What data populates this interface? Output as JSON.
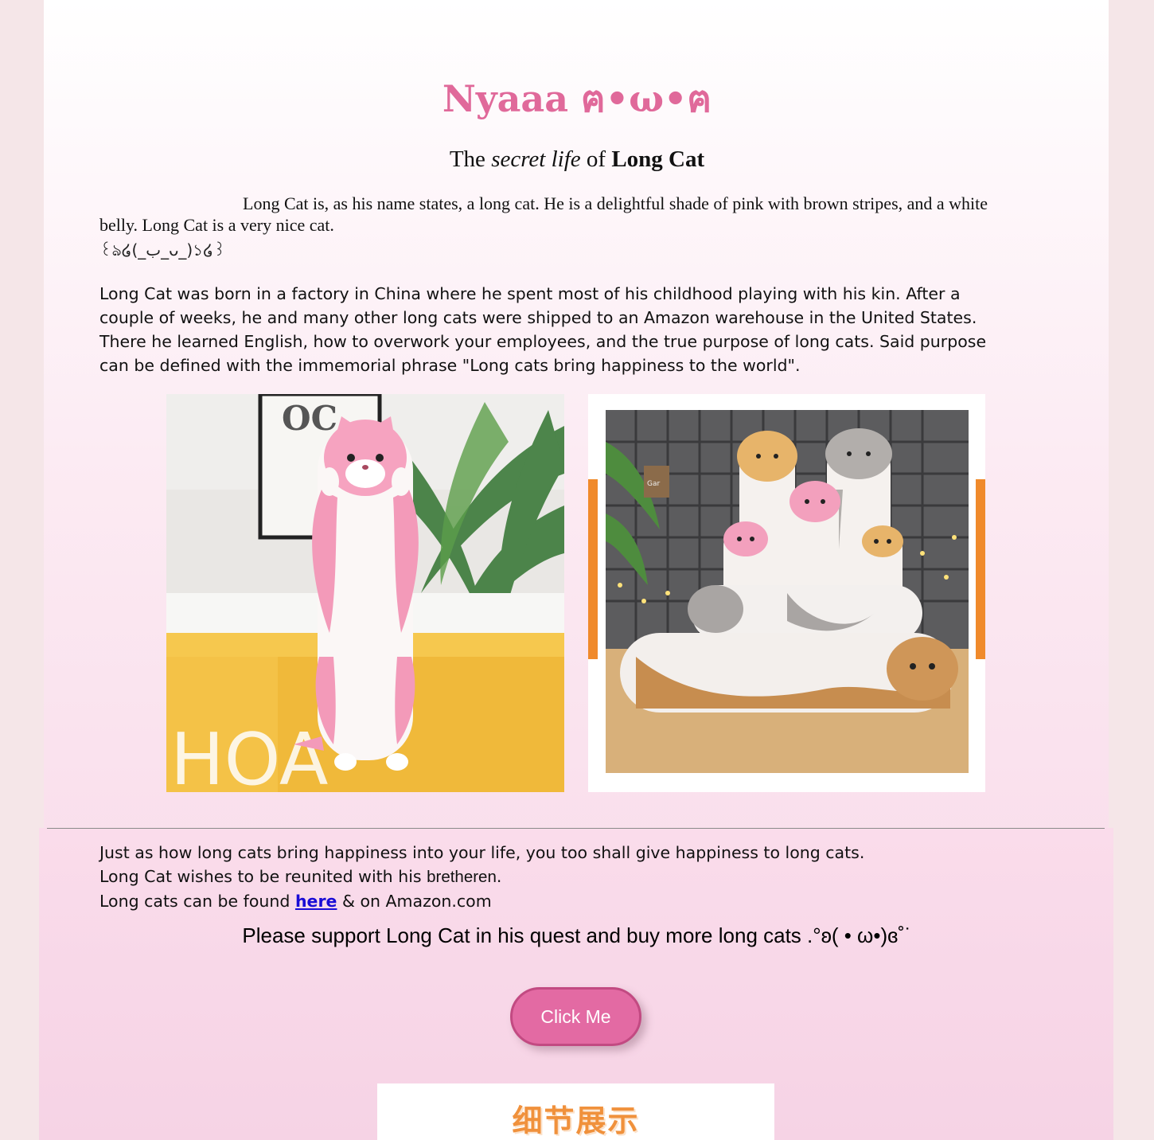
{
  "header": {
    "title": "Nyaaa ฅ•ω•ฅ",
    "subtitle_pre": "The ",
    "subtitle_em": "secret life",
    "subtitle_mid": " of ",
    "subtitle_bold": "Long Cat"
  },
  "intro": {
    "text": "Long Cat is, as his name states, a long cat. He is a delightful shade of pink with brown stripes, and a white belly. Long Cat is a very nice cat.",
    "kaomoji": "꒰ঌ໒(_ب_ᴗ_)১໒꒱"
  },
  "story": {
    "text": "Long Cat was born in a factory in China where he spent most of his childhood playing with his kin. After a couple of weeks, he and many other long cats were shipped to an Amazon warehouse in the United States. There he learned English, how to overwork your employees, and the true purpose of long cats. Said purpose can be defined with the immemorial phrase \"Long cats bring happiness to the world\"."
  },
  "images": {
    "photo1_sign": "OC",
    "photo2_tag": "Gar"
  },
  "outro": {
    "line1": "Just as how long cats bring happiness into your life, you too shall give happiness to long cats.",
    "line2_pre": "Long Cat wishes to be reunited with his ",
    "line2_word": "bretheren",
    "line2_post": ".",
    "line3_pre": "Long cats can be found ",
    "link_label": "here",
    "line3_post": " & on Amazon.com"
  },
  "support": {
    "text": "Please support Long Cat in his quest and buy more long cats .°ʚ( • ω•)ɞ˚˙"
  },
  "cta": {
    "button_label": "Click Me"
  },
  "banner": {
    "text": "细节展示"
  },
  "colors": {
    "accent_pink": "#e0699a",
    "button_pink": "#e36aa3",
    "link_blue": "#1a0dd6",
    "banner_orange": "#f0913c"
  }
}
